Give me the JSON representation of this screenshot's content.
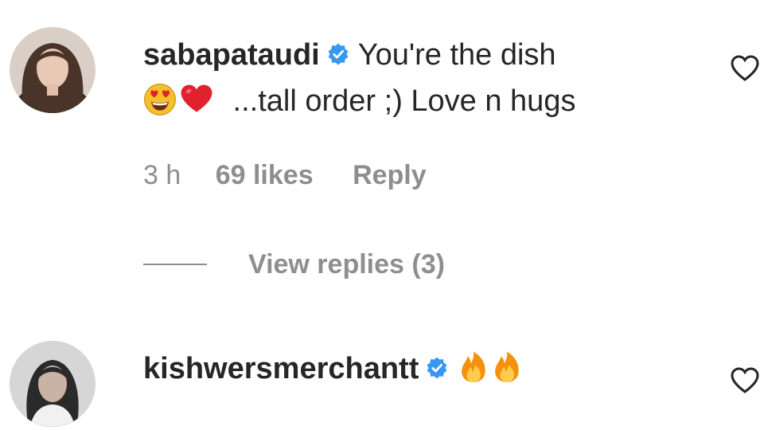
{
  "comments": [
    {
      "username": "sabapataudi",
      "verified_icon": "verified-badge-icon",
      "text_line1": "You're the dish",
      "emoji_1": "heart-eyes-emoji",
      "emoji_2": "red-heart-emoji",
      "text_line2": " ...tall order ;) Love n hugs",
      "time": "3 h",
      "likes": "69 likes",
      "reply": "Reply",
      "view_replies": "View replies (3)",
      "like_icon": "heart-outline-icon"
    },
    {
      "username": "kishwersmerchantt",
      "verified_icon": "verified-badge-icon",
      "emoji_1": "fire-emoji",
      "emoji_2": "fire-emoji",
      "like_icon": "heart-outline-icon"
    }
  ],
  "colors": {
    "text": "#262626",
    "secondary": "#8e8e8e",
    "verified": "#3897f0",
    "heart_red": "#e0212e"
  }
}
